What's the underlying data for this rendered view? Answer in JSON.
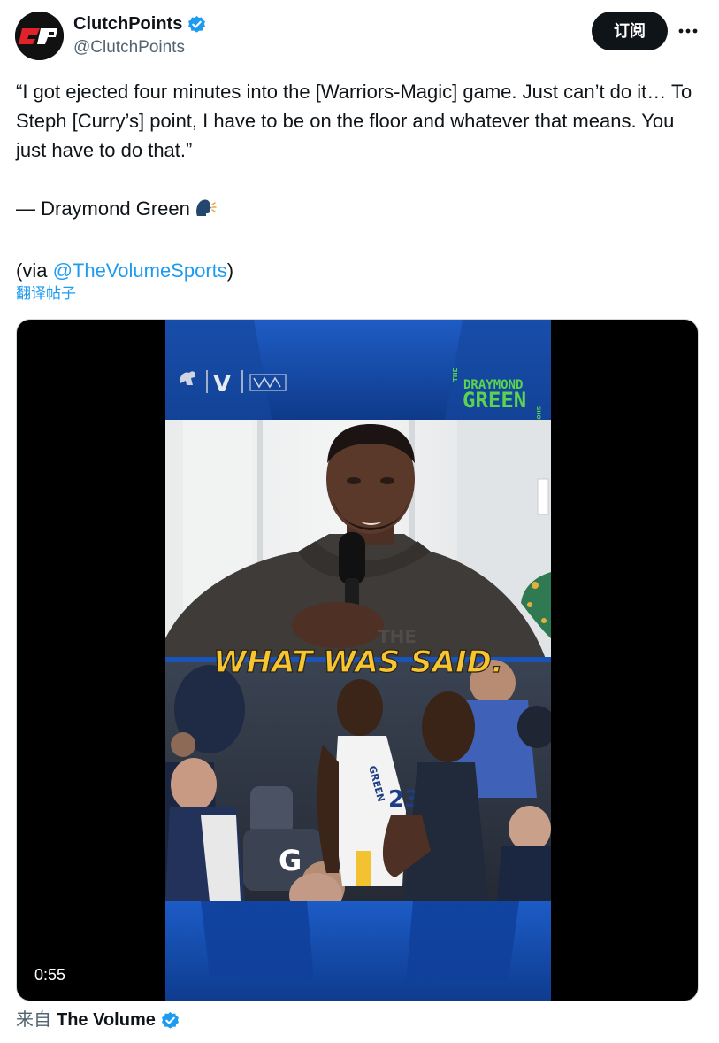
{
  "author": {
    "name": "ClutchPoints",
    "handle": "@ClutchPoints",
    "avatar_text": "CP",
    "verified": true
  },
  "actions": {
    "subscribe_label": "订阅",
    "more_icon": "more-horizontal-icon"
  },
  "tweet": {
    "quote": "“I got ejected four minutes into the [Warriors-Magic] game. Just can’t do it… To Steph [Curry’s] point, I have to be on the floor and whatever that means. You just have to do that.”",
    "attribution": "— Draymond Green",
    "attribution_icon": "speaking-head-icon",
    "via_prefix": "(via ",
    "via_mention": "@TheVolumeSports",
    "via_suffix": ")",
    "translate_label": "翻译帖子"
  },
  "video": {
    "duration": "0:55",
    "caption": "WHAT WAS SAID.",
    "show_logo_line1": "DRAYMOND",
    "show_logo_line2": "GREEN",
    "show_logo_the": "THE",
    "show_logo_show": "SHOW",
    "sponsor_v": "V",
    "jersey_name": "GREEN",
    "jersey_number": "23",
    "hoodie_text": "THE",
    "court_letter": "G"
  },
  "source": {
    "prefix": "来自",
    "name": "The Volume",
    "verified": true
  },
  "colors": {
    "accent": "#1d9bf0",
    "text": "#0f1419",
    "muted": "#536471",
    "caption_yellow": "#f6c531",
    "show_green": "#5ad44f",
    "broadcast_blue": "#1a54b8"
  }
}
